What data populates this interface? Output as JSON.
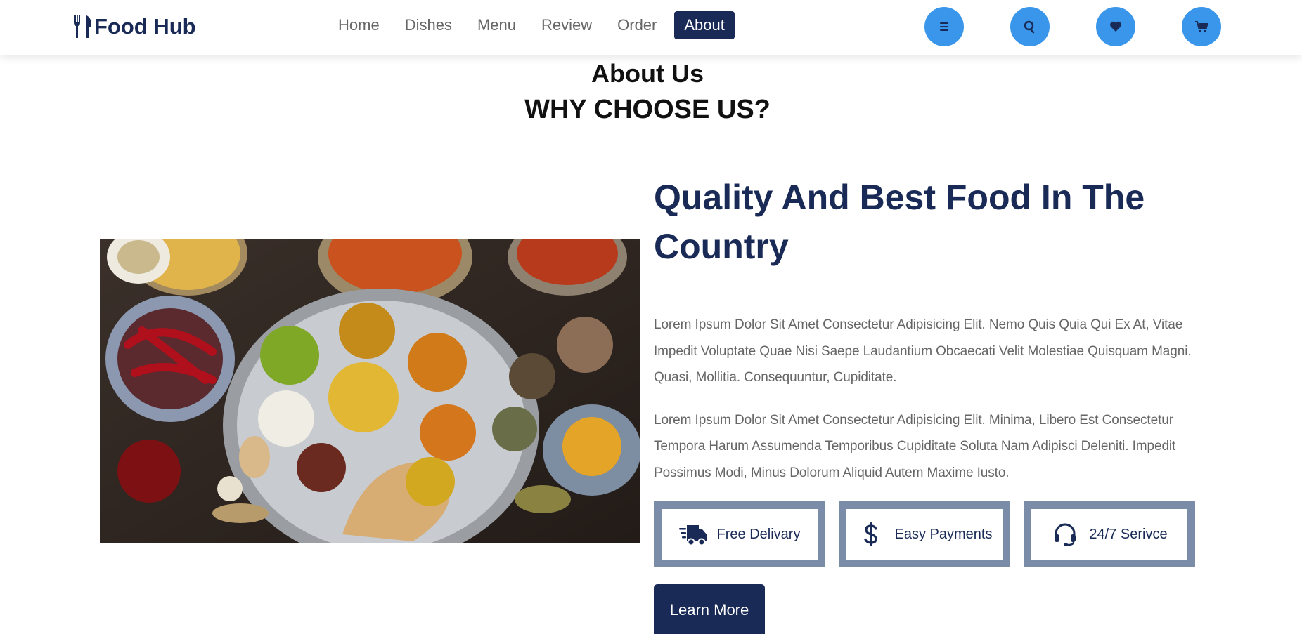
{
  "brand": {
    "name": "Food Hub",
    "icon": "utensils-icon"
  },
  "nav": {
    "items": [
      {
        "label": "Home",
        "active": false
      },
      {
        "label": "Dishes",
        "active": false
      },
      {
        "label": "Menu",
        "active": false
      },
      {
        "label": "Review",
        "active": false
      },
      {
        "label": "Order",
        "active": false
      },
      {
        "label": "About",
        "active": true
      }
    ]
  },
  "header_icons": [
    "menu-bars-icon",
    "search-icon",
    "heart-icon",
    "shopping-cart-icon"
  ],
  "section": {
    "sub_heading": "About Us",
    "heading": "WHY CHOOSE US?"
  },
  "content": {
    "title": "Quality And Best Food In The Country",
    "paragraphs": [
      "Lorem Ipsum Dolor Sit Amet Consectetur Adipisicing Elit. Nemo Quis Quia Qui Ex At, Vitae Impedit Voluptate Quae Nisi Saepe Laudantium Obcaecati Velit Molestiae Quisquam Magni. Quasi, Mollitia. Consequuntur, Cupiditate.",
      "Lorem Ipsum Dolor Sit Amet Consectetur Adipisicing Elit. Minima, Libero Est Consectetur Tempora Harum Assumenda Temporibus Cupiditate Soluta Nam Adipisci Deleniti. Impedit Possimus Modi, Minus Dolorum Aliquid Autem Maxime Iusto."
    ],
    "features": [
      {
        "label": "Free Delivary",
        "icon": "shipping-fast-icon"
      },
      {
        "label": "Easy Payments",
        "icon": "dollar-sign-icon"
      },
      {
        "label": "24/7 Serivce",
        "icon": "headset-icon"
      }
    ],
    "button_label": "Learn More"
  },
  "colors": {
    "primary": "#192a56",
    "accent_blue": "#3a96ea",
    "feature_border": "#7a8ca8",
    "text_gray": "#666666"
  }
}
